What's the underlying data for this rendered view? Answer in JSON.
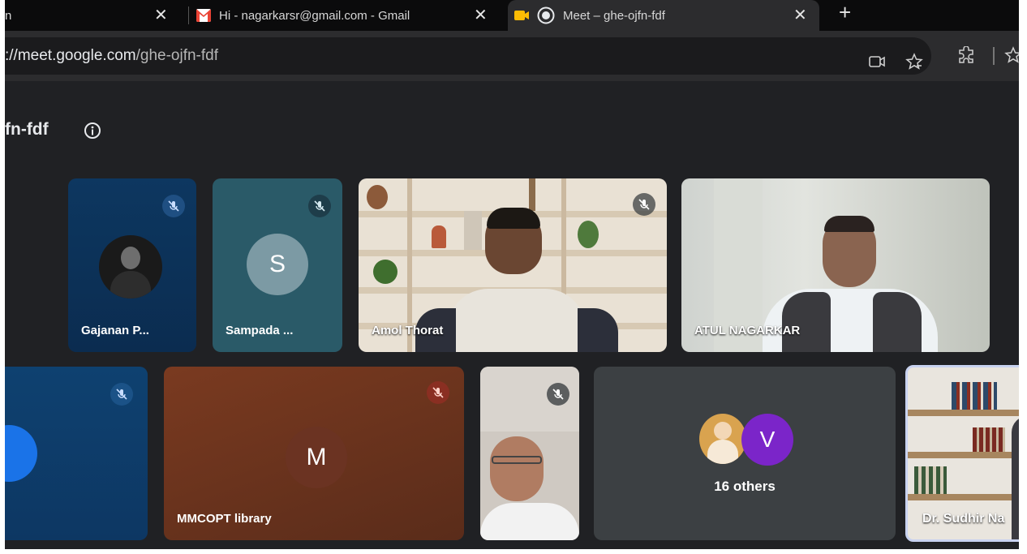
{
  "browser": {
    "tabs": [
      {
        "label": "n"
      },
      {
        "label": "Hi - nagarkarsr@gmail.com - Gmail"
      },
      {
        "label": "Meet – ghe-ojfn-fdf"
      }
    ],
    "address": {
      "domain": "://meet.google.com",
      "path": "/ghe-ojfn-fdf"
    }
  },
  "meeting": {
    "code_title": "fn-fdf",
    "participants": [
      {
        "name": "Gajanan P...",
        "muted": true
      },
      {
        "name": "Sampada ...",
        "initial": "S",
        "muted": true
      },
      {
        "name": "Amol Thorat",
        "muted": true
      },
      {
        "name": "ATUL NAGARKAR",
        "muted": false
      },
      {
        "name": "",
        "muted": true
      },
      {
        "name": "MMCOPT library",
        "initial": "M",
        "muted": true
      },
      {
        "name": "",
        "muted": true
      },
      {
        "name": "Dr. Sudhir Na",
        "muted": false
      }
    ],
    "others": {
      "label": "16 others",
      "initial": "V"
    }
  },
  "colors": {
    "mute_badge_blue": "#1f4f82",
    "mute_badge_red": "#8a2f22",
    "avatar_purple": "#7b25c9"
  }
}
